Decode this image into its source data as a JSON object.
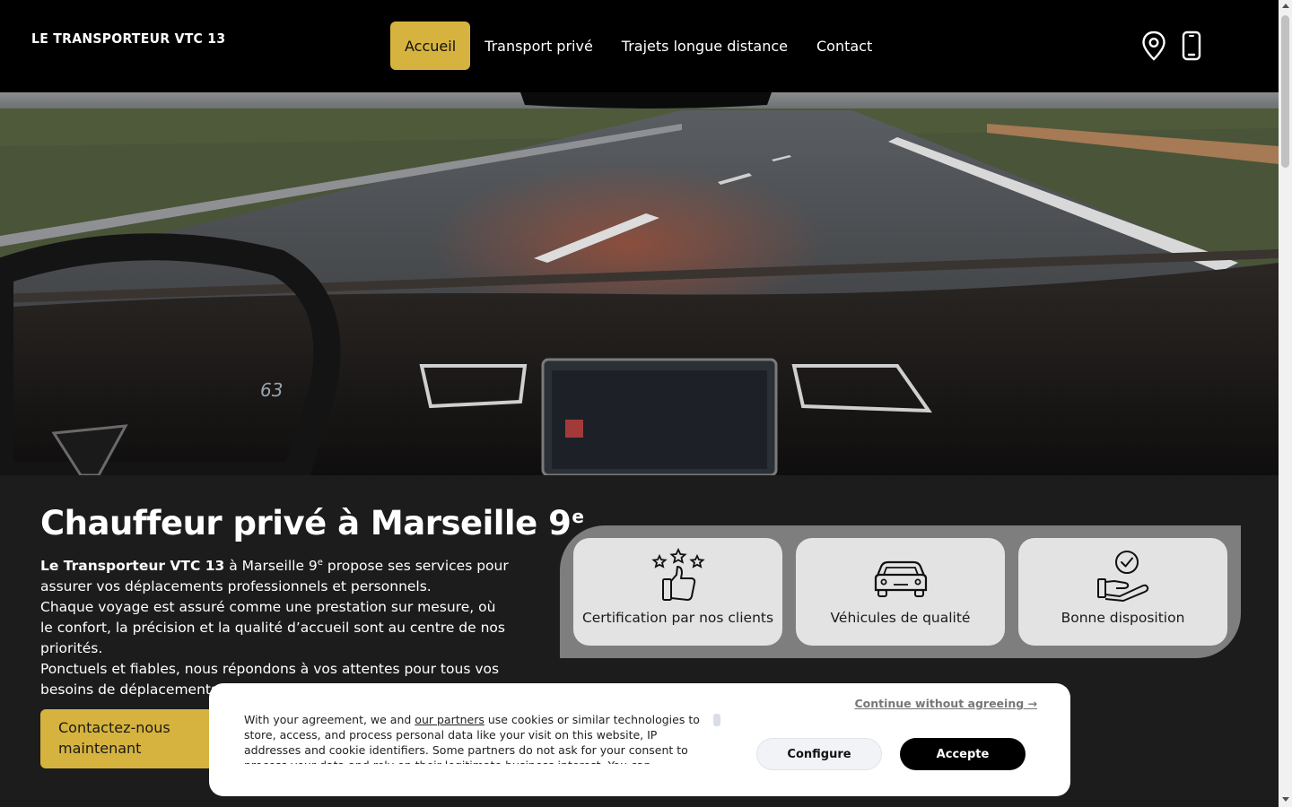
{
  "header": {
    "logo": "LE TRANSPORTEUR VTC 13",
    "nav": [
      "Accueil",
      "Transport privé",
      "Trajets longue distance",
      "Contact"
    ],
    "active_nav": "Accueil",
    "icons": [
      "map-pin-icon",
      "phone-icon"
    ]
  },
  "hero": {
    "speedometer": "63"
  },
  "main": {
    "title": "Chauffeur privé à Marseille 9",
    "title_sup": "e",
    "intro_brand": "Le Transporteur VTC 13",
    "intro_p1_a": " à Marseille 9",
    "intro_p1_sup": "e",
    "intro_p1_b": " propose ses services pour assurer vos déplacements professionnels et personnels.",
    "intro_p2": "Chaque voyage est assuré comme une prestation sur mesure, où le confort, la précision et la qualité d’accueil sont au centre de nos priorités.",
    "intro_p3": "Ponctuels et fiables, nous répondons à vos attentes pour tous vos besoins de déplacements.",
    "cta_label": "Contactez-nous maintenant",
    "features": [
      {
        "label": "Certification par nos clients",
        "icon": "thumbs-up-stars-icon"
      },
      {
        "label": "Véhicules de qualité",
        "icon": "car-icon"
      },
      {
        "label": "Bonne disposition",
        "icon": "hand-check-icon"
      }
    ]
  },
  "cookie": {
    "text_a": "With your agreement, we and ",
    "link": "our partners",
    "text_b": " use cookies or similar technologies to store, access, and process personal data like your visit on this website, IP addresses and cookie identifiers. Some partners do not ask for your consent to process your data and rely on their legitimate business interest. You can",
    "continue": "Continue without agreeing →",
    "configure": "Configure",
    "accept": "Accepte"
  },
  "colors": {
    "accent": "#d6b33e",
    "header_bg": "#000000",
    "page_bg": "#1c1c1c",
    "features_bg": "#7e7e7e",
    "card_bg": "#e3e3e3"
  }
}
